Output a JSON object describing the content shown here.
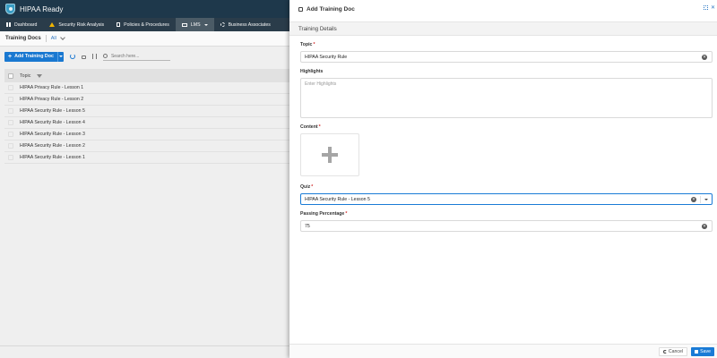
{
  "app": {
    "title": "HIPAA Ready"
  },
  "nav": [
    {
      "label": "Dashboard",
      "icon": "grid-icon"
    },
    {
      "label": "Security Risk Analysis",
      "icon": "warning-icon"
    },
    {
      "label": "Policies & Procedures",
      "icon": "document-icon"
    },
    {
      "label": "LMS",
      "icon": "monitor-icon",
      "active": true
    },
    {
      "label": "Business Associates",
      "icon": "associates-icon"
    }
  ],
  "subheader": {
    "title": "Training Docs",
    "filter": "All"
  },
  "toolbar": {
    "add_label": "Add Training Doc",
    "search_placeholder": "Search here..."
  },
  "table": {
    "header": "Topic",
    "rows": [
      "HIPAA Privacy Rule - Lesson 1",
      "HIPAA Privacy Rule - Lesson 2",
      "HIPAA Security Rule - Lesson 5",
      "HIPAA Security Rule - Lesson 4",
      "HIPAA Security Rule - Lesson 3",
      "HIPAA Security Rule - Lesson 2",
      "HIPAA Security Rule - Lesson 1"
    ]
  },
  "panel": {
    "title": "Add Training Doc",
    "section": "Training Details",
    "topic_label": "Topic",
    "topic_value": "HIPAA Security Rule",
    "highlights_label": "Highlights",
    "highlights_placeholder": "Enter Highlights",
    "content_label": "Content",
    "quiz_label": "Quiz",
    "quiz_value": "HIPAA Security Rule - Lesson 5",
    "passing_label": "Passing Percentage",
    "passing_value": "75",
    "cancel_label": "Cancel",
    "save_label": "Save"
  },
  "colors": {
    "primary": "#1a7bd6",
    "nav_bg": "#2b3e4c",
    "title_bg": "#1f3a4d",
    "required": "#d32f2f"
  }
}
